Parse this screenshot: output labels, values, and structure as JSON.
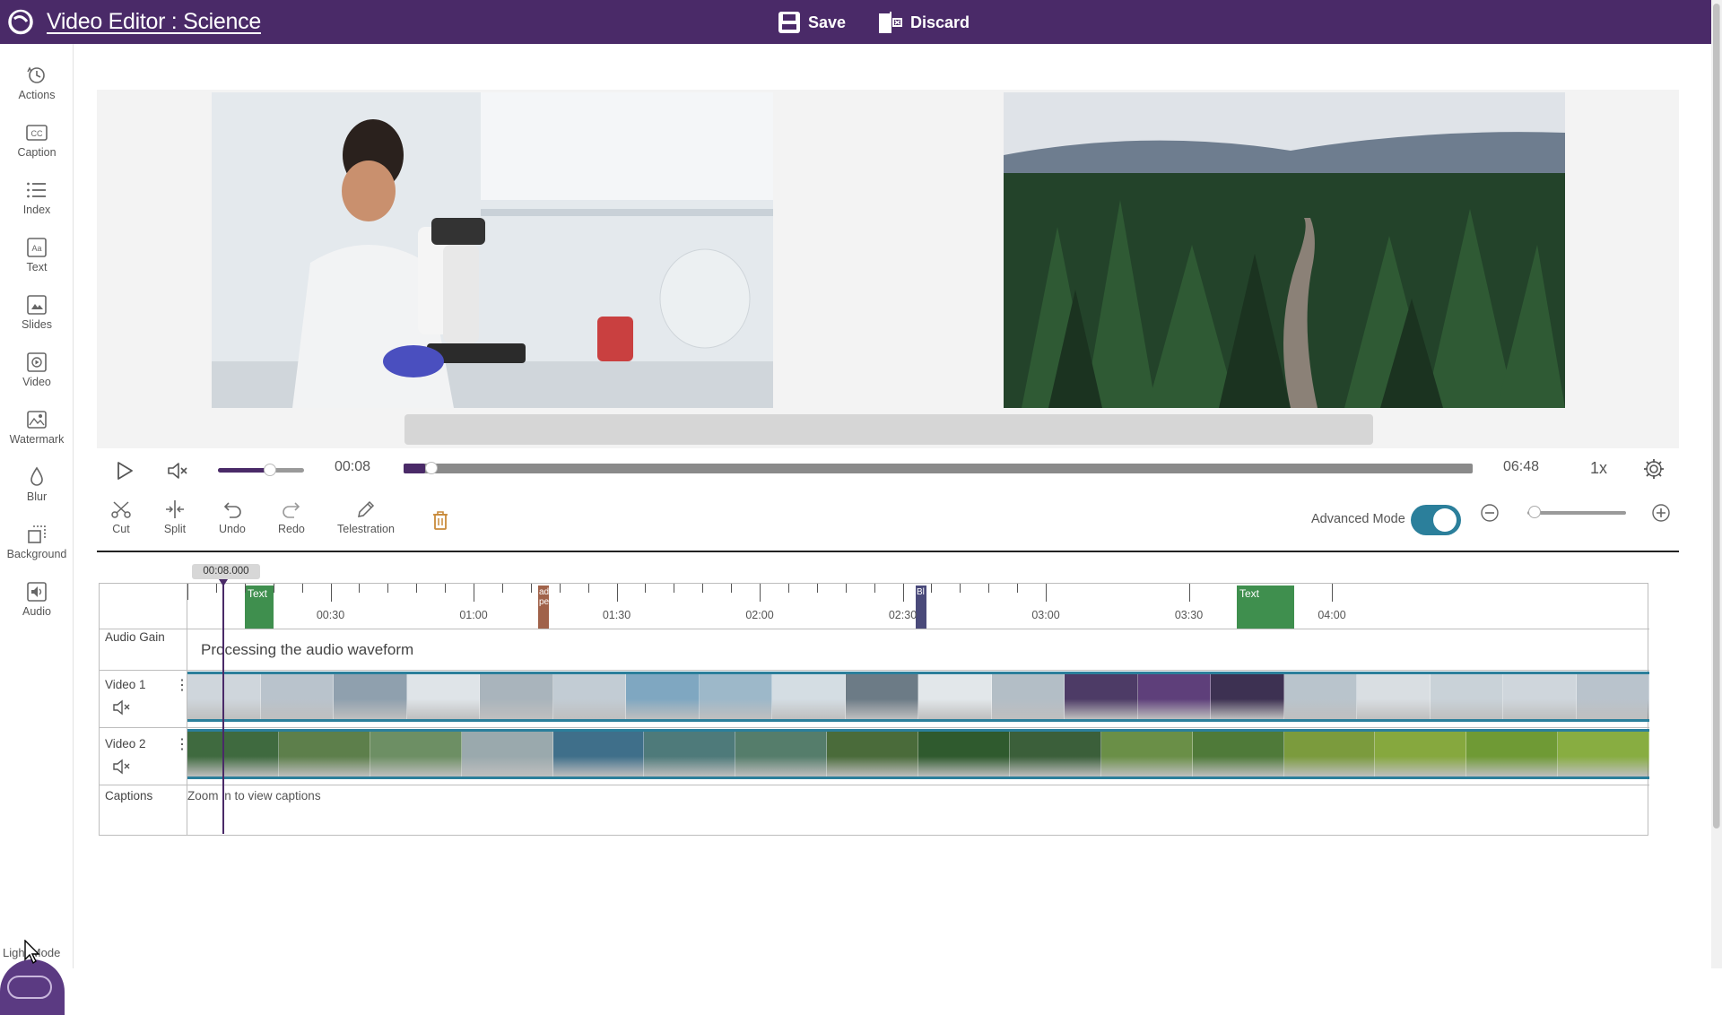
{
  "app": {
    "title": "Video Editor : Science",
    "save_label": "Save",
    "discard_label": "Discard"
  },
  "sidebar": {
    "items": [
      {
        "label": "Actions",
        "icon": "history-icon"
      },
      {
        "label": "Caption",
        "icon": "cc-icon"
      },
      {
        "label": "Index",
        "icon": "list-icon"
      },
      {
        "label": "Text",
        "icon": "text-icon"
      },
      {
        "label": "Slides",
        "icon": "slides-icon"
      },
      {
        "label": "Video",
        "icon": "video-icon"
      },
      {
        "label": "Watermark",
        "icon": "image-icon"
      },
      {
        "label": "Blur",
        "icon": "drop-icon"
      },
      {
        "label": "Background",
        "icon": "background-icon"
      },
      {
        "label": "Audio",
        "icon": "audio-icon"
      }
    ],
    "light_mode_label": "Light Mode"
  },
  "player": {
    "current_time": "00:08",
    "total_time": "06:48",
    "speed": "1x",
    "volume_fraction": 0.6,
    "progress_fraction": 0.02
  },
  "toolbar": {
    "cut": "Cut",
    "split": "Split",
    "undo": "Undo",
    "redo": "Redo",
    "telestration": "Telestration",
    "advanced_mode_label": "Advanced Mode",
    "advanced_mode_on": true
  },
  "timeline": {
    "playhead_time": "00:08.000",
    "ticks": [
      "00:30",
      "01:00",
      "01:30",
      "02:00",
      "02:30",
      "03:00",
      "03:30",
      "04:00"
    ],
    "markers": [
      {
        "label": "Text",
        "color": "#3f8f4e"
      },
      {
        "label": "ad pe",
        "color": "#a0624a"
      },
      {
        "label": "Bl",
        "color": "#4a4a7a"
      },
      {
        "label": "Text",
        "color": "#3f8f4e"
      }
    ],
    "rows": {
      "audio_gain": "Audio Gain",
      "video1": "Video 1",
      "video2": "Video 2",
      "captions": "Captions"
    },
    "audio_processing": "Processing the audio waveform",
    "captions_hint": "Zoom in to view captions"
  },
  "colors": {
    "brand": "#4a2a68",
    "accent": "#2b7f9b"
  }
}
